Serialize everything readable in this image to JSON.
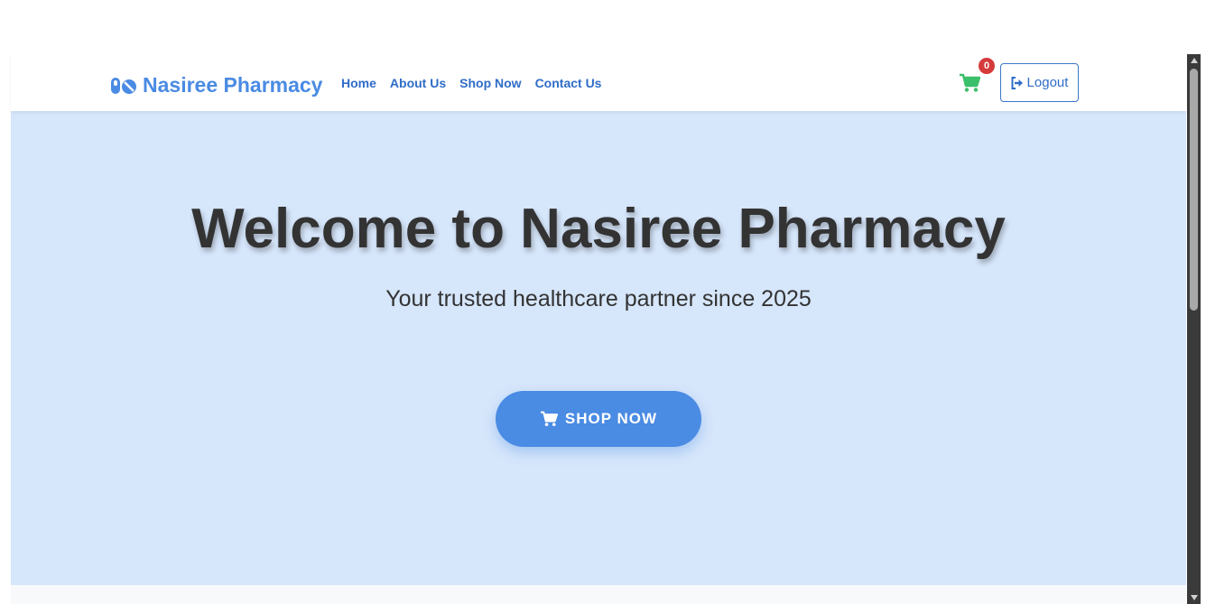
{
  "brand": {
    "name": "Nasiree Pharmacy",
    "icon": "pills-icon",
    "color": "#4a8be3"
  },
  "nav": {
    "links": [
      {
        "label": "Home"
      },
      {
        "label": "About Us"
      },
      {
        "label": "Shop Now"
      },
      {
        "label": "Contact Us"
      }
    ]
  },
  "cart": {
    "icon": "cart-icon",
    "count": "0",
    "icon_color": "#3cbf6a",
    "badge_color": "#d63b3b"
  },
  "logout": {
    "label": "Logout",
    "icon": "sign-out-icon"
  },
  "hero": {
    "title": "Welcome to Nasiree Pharmacy",
    "subtitle": "Your trusted healthcare partner since 2025",
    "cta_label": "SHOP NOW",
    "cta_icon": "cart-icon",
    "background": "#d6e6fb",
    "accent": "#4a8be3"
  }
}
